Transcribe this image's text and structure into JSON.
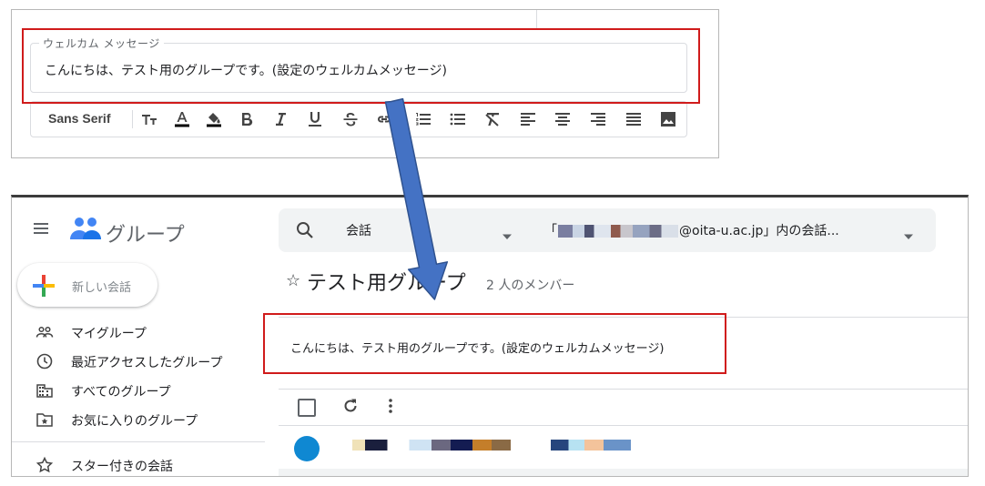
{
  "editor": {
    "field_label": "ウェルカム メッセージ",
    "field_value": "こんにちは、テスト用のグループです。(設定のウェルカムメッセージ)",
    "font_name": "Sans Serif",
    "toolbar_icons": [
      "text-size-icon",
      "text-color-icon",
      "highlight-color-icon",
      "bold-icon",
      "italic-icon",
      "underline-icon",
      "strikethrough-icon",
      "link-icon",
      "numbered-list-icon",
      "bullet-list-icon",
      "clear-format-icon",
      "align-left-icon",
      "align-center-icon",
      "align-right-icon",
      "justify-icon",
      "image-icon"
    ]
  },
  "groups_app": {
    "title": "グループ",
    "new_conversation": "新しい会話",
    "nav": [
      {
        "label": "マイグループ",
        "icon": "people-icon"
      },
      {
        "label": "最近アクセスしたグループ",
        "icon": "clock-icon"
      },
      {
        "label": "すべてのグループ",
        "icon": "building-icon"
      },
      {
        "label": "お気に入りのグループ",
        "icon": "folder-star-icon"
      },
      {
        "label": "スター付きの会話",
        "icon": "star-icon"
      }
    ],
    "search": {
      "scope": "会話",
      "placeholder_prefix": "「",
      "placeholder_suffix": "@oita-u.ac.jp」内の会話..."
    },
    "group": {
      "star": "☆",
      "name": "テスト用グループ",
      "member_count": "2 人のメンバー",
      "welcome_message": "こんにちは、テスト用のグループです。(設定のウェルカムメッセージ)"
    }
  },
  "colors": {
    "highlight_box": "#d01b1b",
    "arrow_fill": "#4472c4",
    "arrow_stroke": "#2f528f",
    "avatar": "#0f88d2"
  }
}
